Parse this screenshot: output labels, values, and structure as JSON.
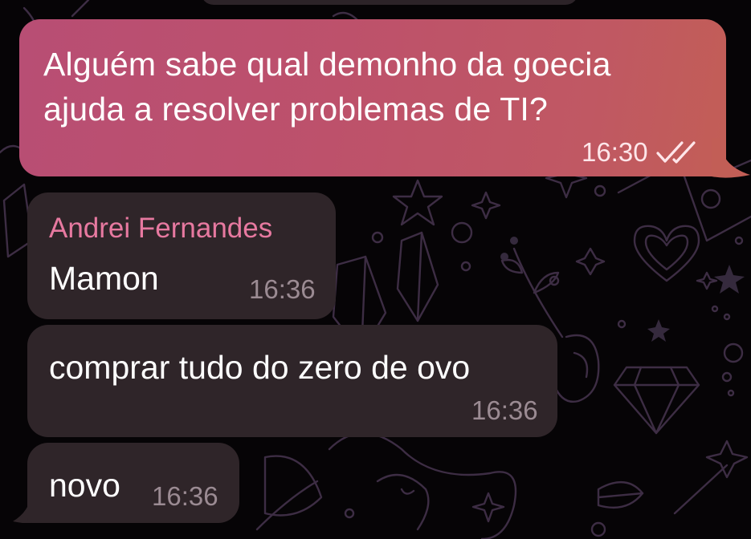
{
  "chat": {
    "messages": [
      {
        "direction": "outgoing",
        "text": "Alguém sabe qual demonho da goecia\najuda a resolver problemas de TI?",
        "time": "16:30",
        "status_icon": "double-check-icon"
      },
      {
        "direction": "incoming",
        "sender": "Andrei Fernandes",
        "text": "Mamon",
        "time": "16:36"
      },
      {
        "direction": "incoming",
        "text": "comprar tudo do zero de ovo",
        "time": "16:36"
      },
      {
        "direction": "incoming",
        "text": "novo",
        "time": "16:36"
      }
    ]
  },
  "colors": {
    "sender_name": "#e779a0",
    "incoming_bubble": "#2f2529",
    "outgoing_gradient_start": "#b84e74",
    "outgoing_gradient_end": "#c25e56",
    "background": "#060406"
  }
}
